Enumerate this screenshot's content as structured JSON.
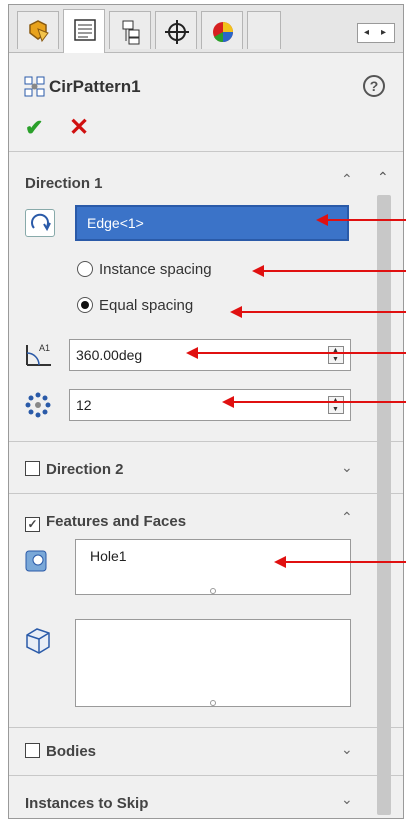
{
  "feature": {
    "title": "CirPattern1",
    "help_label": "?"
  },
  "direction1": {
    "title": "Direction 1",
    "edge_value": "Edge<1>",
    "spacing_options": [
      "Instance spacing",
      "Equal spacing"
    ],
    "selected_spacing": "Equal spacing",
    "angle_value": "360.00deg",
    "instances_value": "12"
  },
  "direction2": {
    "title": "Direction 2",
    "checked": false
  },
  "features_faces": {
    "title": "Features and Faces",
    "checked": true,
    "features_value": "Hole1",
    "faces_value": ""
  },
  "bodies": {
    "title": "Bodies",
    "checked": false
  },
  "instances_to_skip": {
    "title": "Instances to Skip"
  },
  "colors": {
    "selection_blue": "#3b73c8",
    "callout_red": "#e01010",
    "ok_green": "#2aa02a",
    "cancel_red": "#d01010"
  },
  "icons": [
    "feature-manager-tab-icon",
    "property-manager-tab-icon",
    "configuration-manager-tab-icon",
    "dimxpert-tab-icon",
    "display-manager-tab-icon"
  ]
}
